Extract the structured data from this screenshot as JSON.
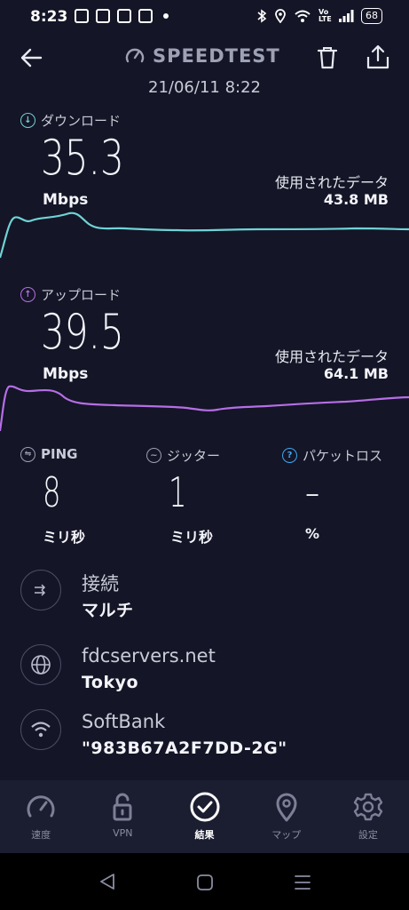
{
  "status_bar": {
    "time": "8:23",
    "right_icons": [
      "bluetooth-icon",
      "location-icon",
      "wifi-icon",
      "volte-icon",
      "signal-icon"
    ],
    "volte": "Vo LTE",
    "battery": "68"
  },
  "header": {
    "title": "SPEEDTEST",
    "datetime": "21/06/11 8:22"
  },
  "download": {
    "label": "ダウンロード",
    "value": "35.3",
    "unit": "Mbps",
    "data_used_label": "使用されたデータ",
    "data_used_value": "43.8 MB",
    "color": "#6fd3d6"
  },
  "upload": {
    "label": "アップロード",
    "value": "39.5",
    "unit": "Mbps",
    "data_used_label": "使用されたデータ",
    "data_used_value": "64.1 MB",
    "color": "#b66ee6"
  },
  "ping": {
    "label": "PING",
    "value": "8",
    "unit": "ミリ秒"
  },
  "jitter": {
    "label": "ジッター",
    "value": "1",
    "unit": "ミリ秒"
  },
  "packet_loss": {
    "label": "パケットロス",
    "value": "–",
    "unit": "%"
  },
  "connection": {
    "title": "接続",
    "sub": "マルチ"
  },
  "server": {
    "title": "fdcservers.net",
    "sub": "Tokyo"
  },
  "network": {
    "title": "SoftBank",
    "sub": "\"983B67A2F7DD-2G\""
  },
  "bottom_nav": [
    {
      "label": "速度",
      "icon": "speedometer-icon",
      "active": false
    },
    {
      "label": "VPN",
      "icon": "lock-icon",
      "active": false
    },
    {
      "label": "結果",
      "icon": "check-circle-icon",
      "active": true
    },
    {
      "label": "マップ",
      "icon": "map-pin-icon",
      "active": false
    },
    {
      "label": "設定",
      "icon": "gear-icon",
      "active": false
    }
  ]
}
